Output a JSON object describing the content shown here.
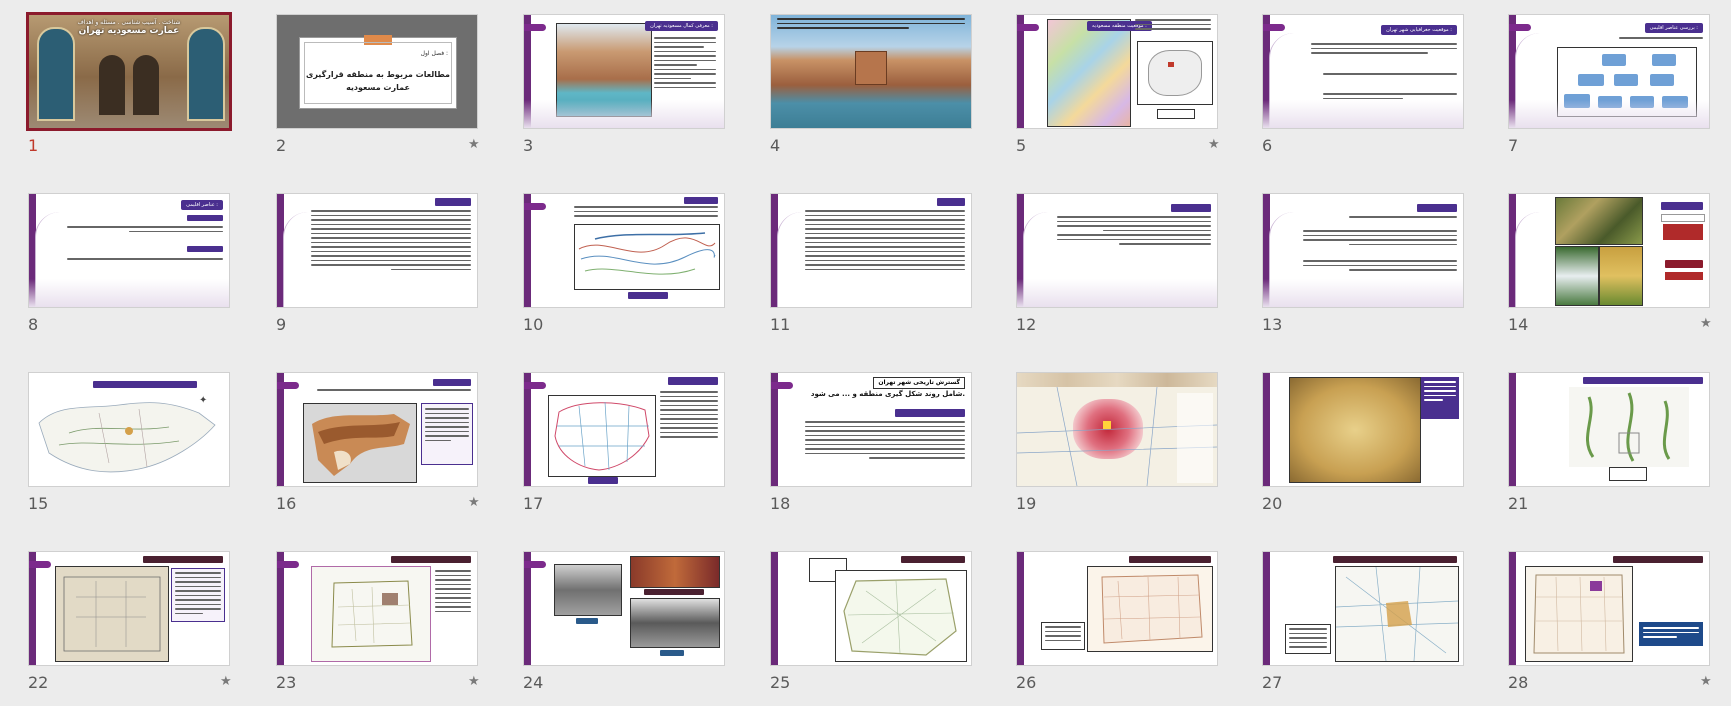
{
  "slides": [
    {
      "num": "1",
      "title_lines": [
        "شناخت . آسیب شناسی . مسئله و اهداف",
        "عمارت مسعودیه تهران"
      ],
      "starred": false,
      "selected": true
    },
    {
      "num": "2",
      "title_lines": [
        "فصل اول :",
        "مطالعات مربوط به منطقه قرارگیری",
        "عمارت مسعودیه"
      ],
      "starred": true,
      "selected": false
    },
    {
      "num": "3",
      "title_lines": [
        "معرفی کمال مسعودیه تهران :"
      ],
      "starred": false,
      "selected": false
    },
    {
      "num": "4",
      "title_lines": [],
      "starred": false,
      "selected": false
    },
    {
      "num": "5",
      "title_lines": [
        "موقعیت منطقه مسعودیه :"
      ],
      "starred": true,
      "selected": false
    },
    {
      "num": "6",
      "title_lines": [
        "موقعیت جغرافیایی شهر تهران :"
      ],
      "starred": false,
      "selected": false
    },
    {
      "num": "7",
      "title_lines": [
        "بررسی عناصر اقلیمی :"
      ],
      "starred": false,
      "selected": false
    },
    {
      "num": "8",
      "title_lines": [
        "عناصر اقلیمی :"
      ],
      "starred": false,
      "selected": false
    },
    {
      "num": "9",
      "title_lines": [],
      "starred": false,
      "selected": false
    },
    {
      "num": "10",
      "title_lines": [],
      "starred": false,
      "selected": false
    },
    {
      "num": "11",
      "title_lines": [],
      "starred": false,
      "selected": false
    },
    {
      "num": "12",
      "title_lines": [],
      "starred": false,
      "selected": false
    },
    {
      "num": "13",
      "title_lines": [],
      "starred": false,
      "selected": false
    },
    {
      "num": "14",
      "title_lines": [],
      "starred": true,
      "selected": false
    },
    {
      "num": "15",
      "title_lines": [],
      "starred": false,
      "selected": false
    },
    {
      "num": "16",
      "title_lines": [],
      "starred": true,
      "selected": false
    },
    {
      "num": "17",
      "title_lines": [],
      "starred": false,
      "selected": false
    },
    {
      "num": "18",
      "title_lines": [
        "گسترش تاریخی شهر تهران",
        "شامل روند شکل گیری منطقه و ... می شود."
      ],
      "starred": false,
      "selected": false
    },
    {
      "num": "19",
      "title_lines": [],
      "starred": false,
      "selected": false
    },
    {
      "num": "20",
      "title_lines": [],
      "starred": false,
      "selected": false
    },
    {
      "num": "21",
      "title_lines": [],
      "starred": false,
      "selected": false
    },
    {
      "num": "22",
      "title_lines": [],
      "starred": true,
      "selected": false
    },
    {
      "num": "23",
      "title_lines": [],
      "starred": true,
      "selected": false
    },
    {
      "num": "24",
      "title_lines": [],
      "starred": false,
      "selected": false
    },
    {
      "num": "25",
      "title_lines": [],
      "starred": false,
      "selected": false
    },
    {
      "num": "26",
      "title_lines": [],
      "starred": false,
      "selected": false
    },
    {
      "num": "27",
      "title_lines": [],
      "starred": false,
      "selected": false
    },
    {
      "num": "28",
      "title_lines": [],
      "starred": true,
      "selected": false
    }
  ],
  "star_glyph": "★",
  "colors": {
    "accent": "#6b2a7a",
    "selected": "#8b1a2c",
    "pill": "#4a2f8f",
    "background": "#ececec"
  }
}
